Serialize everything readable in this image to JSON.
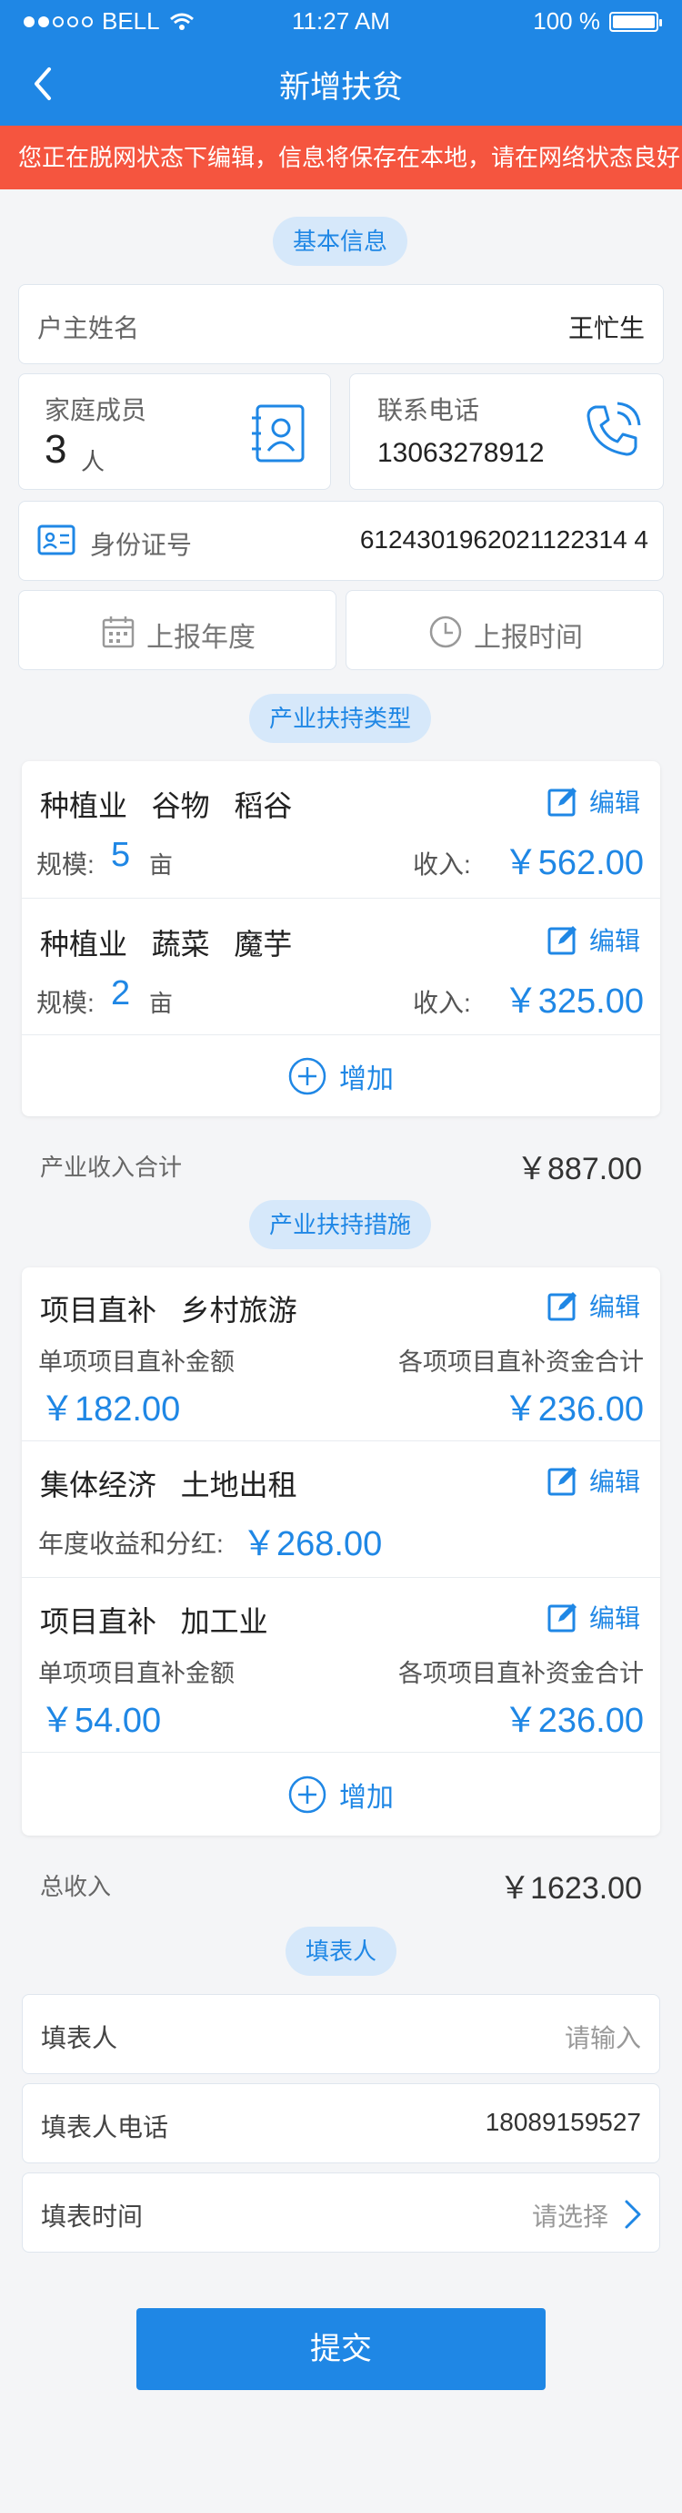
{
  "status_bar": {
    "carrier": "BELL",
    "time": "11:27 AM",
    "battery": "100 %"
  },
  "nav": {
    "title": "新增扶贫"
  },
  "offline_notice": "您正在脱网状态下编辑，信息将保存在本地，请在网络状态良好时",
  "sections": {
    "basic": "基本信息",
    "industry_type": "产业扶持类型",
    "industry_measures": "产业扶持措施",
    "filler": "填表人"
  },
  "basic": {
    "owner_label": "户主姓名",
    "owner_value": "王忙生",
    "family_label": "家庭成员",
    "family_count": "3",
    "family_unit": "人",
    "phone_label": "联系电话",
    "phone_value": "13063278912",
    "id_label": "身份证号",
    "id_value": "6124301962021122314 4",
    "report_year": "上报年度",
    "report_time": "上报时间"
  },
  "industry_types": {
    "items": [
      {
        "title": "种植业   谷物   稻谷",
        "scale_label": "规模:",
        "scale_value": "5",
        "scale_unit": "亩",
        "income_label": "收入:",
        "income_value": "￥562.00",
        "edit": "编辑"
      },
      {
        "title": "种植业   蔬菜   魔芋",
        "scale_label": "规模:",
        "scale_value": "2",
        "scale_unit": "亩",
        "income_label": "收入:",
        "income_value": "￥325.00",
        "edit": "编辑"
      }
    ],
    "add": "增加",
    "total_label": "产业收入合计",
    "total_value": "￥887.00"
  },
  "measures": {
    "items": [
      {
        "title": "项目直补   乡村旅游",
        "left_label": "单项项目直补金额",
        "left_value": "￥182.00",
        "right_label": "各项项目直补资金合计",
        "right_value": "￥236.00",
        "edit": "编辑"
      },
      {
        "title": "集体经济   土地出租",
        "left_label": "年度收益和分红:",
        "left_value": "￥268.00",
        "edit": "编辑"
      },
      {
        "title": "项目直补   加工业",
        "left_label": "单项项目直补金额",
        "left_value": "￥54.00",
        "right_label": "各项项目直补资金合计",
        "right_value": "￥236.00",
        "edit": "编辑"
      }
    ],
    "add": "增加",
    "total_label": "总收入",
    "total_value": "￥1623.00"
  },
  "filler": {
    "name_label": "填表人",
    "name_placeholder": "请输入",
    "phone_label": "填表人电话",
    "phone_value": "18089159527",
    "time_label": "填表时间",
    "time_placeholder": "请选择"
  },
  "submit": "提交",
  "colors": {
    "primary": "#1f87e5",
    "warning": "#f5553f",
    "pill_bg": "#d6e8fa"
  }
}
